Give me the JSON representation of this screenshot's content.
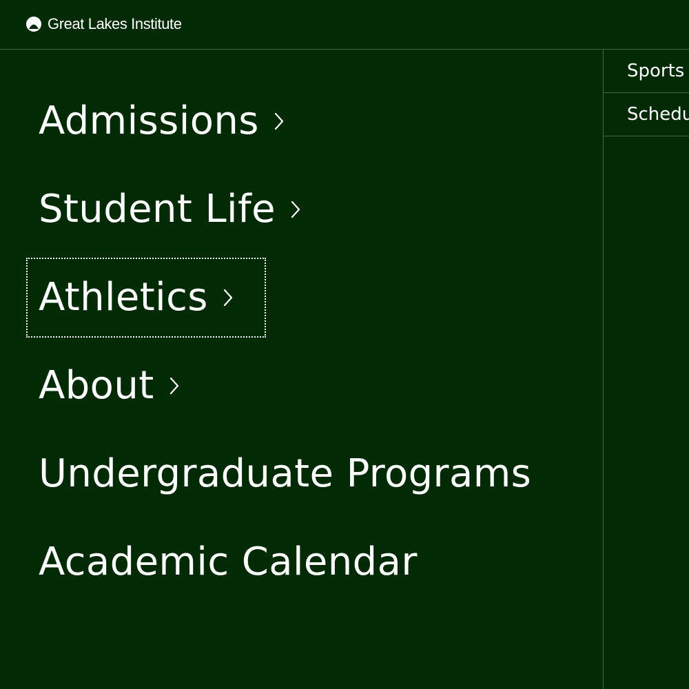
{
  "header": {
    "logo_icon": "droplet-arch-icon",
    "brand_name": "Great Lakes Institute"
  },
  "menu": {
    "items": [
      {
        "label": "Admissions",
        "has_submenu": true,
        "icon": "chevron-right-icon"
      },
      {
        "label": "Student Life",
        "has_submenu": true,
        "icon": "chevron-right-icon"
      },
      {
        "label": "Athletics",
        "has_submenu": true,
        "icon": "chevron-right-icon",
        "focused": true
      },
      {
        "label": "About",
        "has_submenu": true,
        "icon": "chevron-right-icon"
      },
      {
        "label": "Undergraduate Programs",
        "has_submenu": false
      },
      {
        "label": "Academic Calendar",
        "has_submenu": false
      }
    ]
  },
  "submenu": {
    "items": [
      {
        "label": "Sports"
      },
      {
        "label": "Schedu"
      }
    ]
  },
  "colors": {
    "background": "#022b05",
    "text": "#ffffff",
    "divider": "#3f6b41"
  }
}
